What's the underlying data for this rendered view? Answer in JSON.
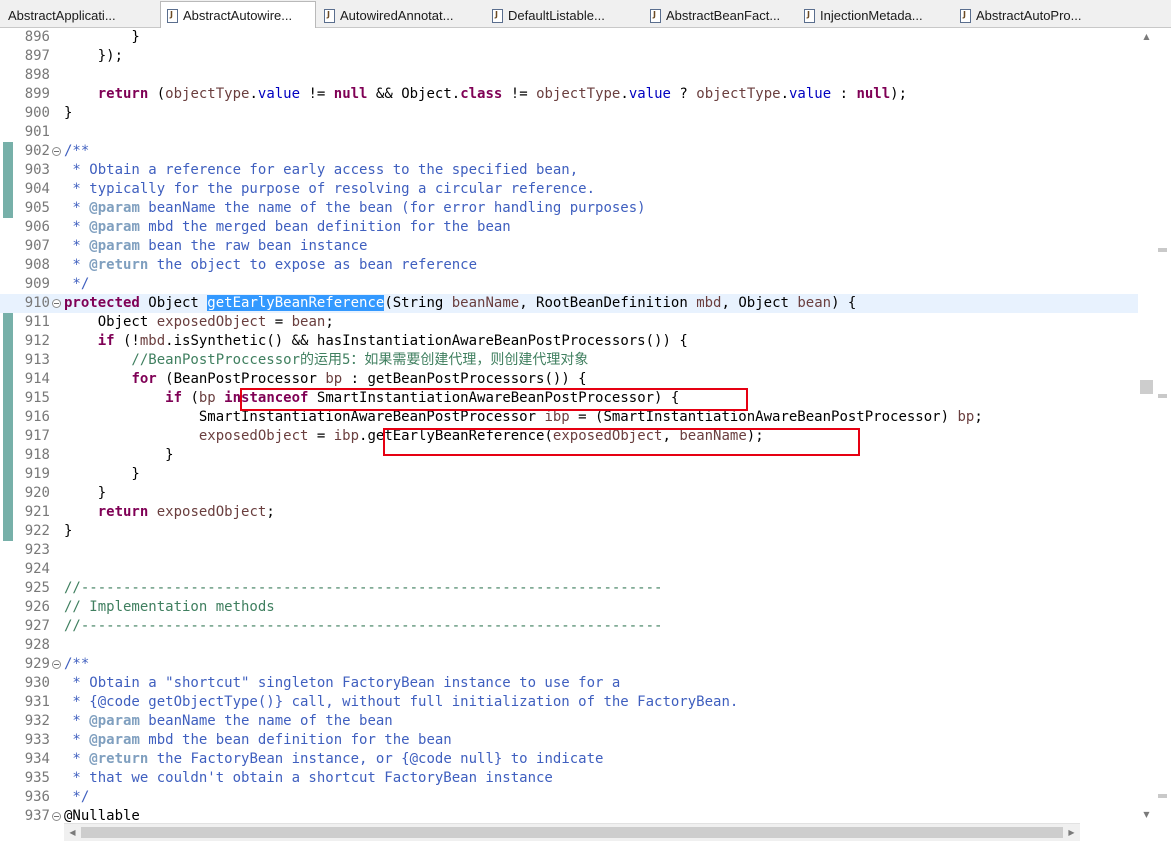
{
  "tabs": [
    {
      "label": "AbstractApplicati...",
      "active": false
    },
    {
      "label": "AbstractAutowire...",
      "active": true
    },
    {
      "label": "AutowiredAnnotat...",
      "active": false
    },
    {
      "label": "DefaultListable...",
      "active": false
    },
    {
      "label": "AbstractBeanFact...",
      "active": false
    },
    {
      "label": "InjectionMetada...",
      "active": false
    },
    {
      "label": "AbstractAutoPro...",
      "active": false
    }
  ],
  "tab_icon": "java-class-file-icon",
  "colors": {
    "keyword": "#7f0055",
    "field": "#0000c0",
    "local_variable": "#6a3e3e",
    "javadoc": "#3f5fbf",
    "javadoc_tag": "#7f9fbf",
    "comment": "#3f7f5f",
    "selection": "#3399ff",
    "current_line": "#e8f2fe",
    "annotation_box": "#e60012",
    "change_marker": "#77b0a9"
  },
  "lines": [
    {
      "n": "896",
      "code": "        }"
    },
    {
      "n": "897",
      "code": "    });"
    },
    {
      "n": "898",
      "code": ""
    },
    {
      "n": "899",
      "code": "    return (objectType.value != null && Object.class != objectType.value ? objectType.value : null);"
    },
    {
      "n": "900",
      "code": "}"
    },
    {
      "n": "901",
      "code": ""
    },
    {
      "n": "902",
      "code": "/**",
      "fold": true
    },
    {
      "n": "903",
      "code": " * Obtain a reference for early access to the specified bean,"
    },
    {
      "n": "904",
      "code": " * typically for the purpose of resolving a circular reference."
    },
    {
      "n": "905",
      "code": " * @param beanName the name of the bean (for error handling purposes)"
    },
    {
      "n": "906",
      "code": " * @param mbd the merged bean definition for the bean"
    },
    {
      "n": "907",
      "code": " * @param bean the raw bean instance"
    },
    {
      "n": "908",
      "code": " * @return the object to expose as bean reference"
    },
    {
      "n": "909",
      "code": " */"
    },
    {
      "n": "910",
      "code": "protected Object getEarlyBeanReference(String beanName, RootBeanDefinition mbd, Object bean) {",
      "fold": true,
      "highlight": true
    },
    {
      "n": "911",
      "code": "    Object exposedObject = bean;"
    },
    {
      "n": "912",
      "code": "    if (!mbd.isSynthetic() && hasInstantiationAwareBeanPostProcessors()) {"
    },
    {
      "n": "913",
      "code": "        //BeanPostProccessor的运用5：如果需要创建代理，则创建代理对象"
    },
    {
      "n": "914",
      "code": "        for (BeanPostProcessor bp : getBeanPostProcessors()) {"
    },
    {
      "n": "915",
      "code": "            if (bp instanceof SmartInstantiationAwareBeanPostProcessor) {"
    },
    {
      "n": "916",
      "code": "                SmartInstantiationAwareBeanPostProcessor ibp = (SmartInstantiationAwareBeanPostProcessor) bp;"
    },
    {
      "n": "917",
      "code": "                exposedObject = ibp.getEarlyBeanReference(exposedObject, beanName);"
    },
    {
      "n": "918",
      "code": "            }"
    },
    {
      "n": "919",
      "code": "        }"
    },
    {
      "n": "920",
      "code": "    }"
    },
    {
      "n": "921",
      "code": "    return exposedObject;"
    },
    {
      "n": "922",
      "code": "}"
    },
    {
      "n": "923",
      "code": ""
    },
    {
      "n": "924",
      "code": ""
    },
    {
      "n": "925",
      "code": "//---------------------------------------------------------------------"
    },
    {
      "n": "926",
      "code": "// Implementation methods"
    },
    {
      "n": "927",
      "code": "//---------------------------------------------------------------------"
    },
    {
      "n": "928",
      "code": ""
    },
    {
      "n": "929",
      "code": "/**",
      "fold": true
    },
    {
      "n": "930",
      "code": " * Obtain a \"shortcut\" singleton FactoryBean instance to use for a"
    },
    {
      "n": "931",
      "code": " * {@code getObjectType()} call, without full initialization of the FactoryBean."
    },
    {
      "n": "932",
      "code": " * @param beanName the name of the bean"
    },
    {
      "n": "933",
      "code": " * @param mbd the bean definition for the bean"
    },
    {
      "n": "934",
      "code": " * @return the FactoryBean instance, or {@code null} to indicate"
    },
    {
      "n": "935",
      "code": " * that we couldn't obtain a shortcut FactoryBean instance"
    },
    {
      "n": "936",
      "code": " */"
    },
    {
      "n": "937",
      "code": "@Nullable",
      "fold": true
    }
  ],
  "selection": "getEarlyBeanReference",
  "annotations": [
    {
      "text": "bp instanceof SmartInstantiationAwareBeanPostProcessor)"
    },
    {
      "text": "ibp.getEarlyBeanReference(exposedObject, beanName);"
    }
  ]
}
